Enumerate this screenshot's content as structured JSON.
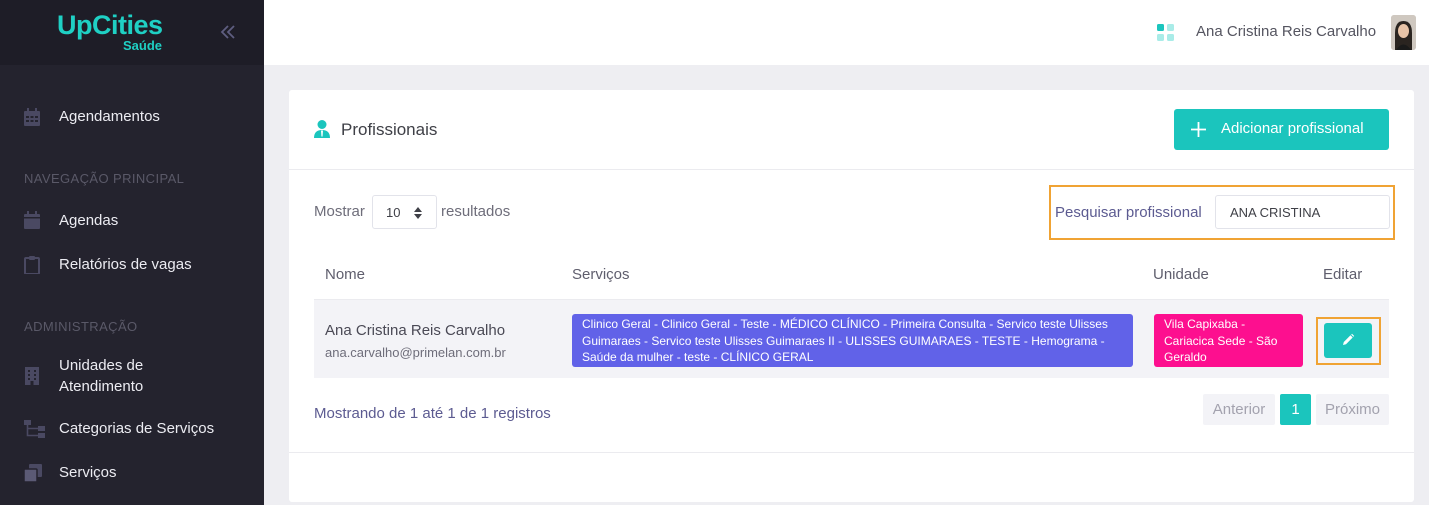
{
  "brand": {
    "name": "UpCities",
    "sub": "Saúde"
  },
  "sidebar": {
    "items": [
      {
        "label": "Agendamentos",
        "icon": "calendar-icon"
      },
      {
        "label": "Agendas",
        "icon": "calendar-icon"
      },
      {
        "label": "Relatórios de vagas",
        "icon": "clipboard-icon"
      },
      {
        "label": "Unidades de Atendimento",
        "icon": "building-icon"
      },
      {
        "label": "Categorias de Serviços",
        "icon": "hierarchy-icon"
      },
      {
        "label": "Serviços",
        "icon": "layers-icon"
      }
    ],
    "headings": [
      "NAVEGAÇÃO PRINCIPAL",
      "ADMINISTRAÇÃO"
    ]
  },
  "topbar": {
    "user_name": "Ana Cristina Reis Carvalho"
  },
  "page": {
    "title": "Profissionais",
    "add_button": "Adicionar profissional",
    "show_label": "Mostrar",
    "page_size": "10",
    "results_label": "resultados",
    "search_label": "Pesquisar profissional",
    "search_value": "ANA CRISTINA"
  },
  "table": {
    "headers": [
      "Nome",
      "Serviços",
      "Unidade",
      "Editar"
    ],
    "rows": [
      {
        "name": "Ana Cristina Reis Carvalho",
        "email": "ana.carvalho@primelan.com.br",
        "services": "Clinico Geral - Clinico Geral - Teste - MÉDICO CLÍNICO - Primeira Consulta - Servico teste Ulisses Guimaraes - Servico teste Ulisses Guimaraes II - ULISSES GUIMARAES - TESTE - Hemograma - Saúde da mulher - teste - CLÍNICO GERAL",
        "unit": "Vila Capixaba - Cariacica Sede - São Geraldo"
      }
    ]
  },
  "footer": {
    "info": "Mostrando de 1 até 1 de 1 registros",
    "prev": "Anterior",
    "page": "1",
    "next": "Próximo"
  },
  "colors": {
    "accent": "#1bc5bd",
    "sidebar": "#24232e",
    "services_badge": "#6162e8",
    "unit_badge": "#fd0f8f",
    "highlight": "#f0a334"
  }
}
